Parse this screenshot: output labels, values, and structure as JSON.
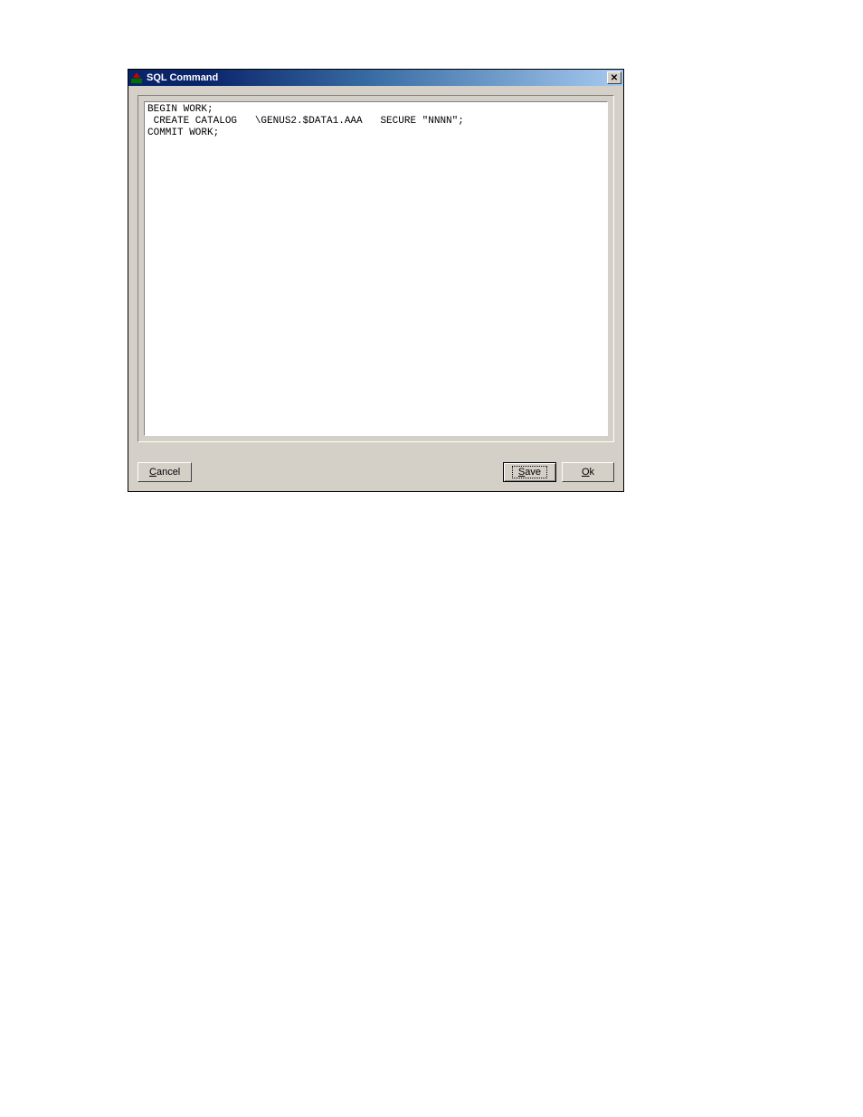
{
  "titlebar": {
    "title": "SQL Command"
  },
  "textarea": {
    "content": "BEGIN WORK;\n CREATE CATALOG   \\GENUS2.$DATA1.AAA   SECURE \"NNNN\";\nCOMMIT WORK;"
  },
  "buttons": {
    "cancel": {
      "u": "C",
      "rest": "ancel"
    },
    "save": {
      "u": "S",
      "rest": "ave"
    },
    "ok": {
      "u": "O",
      "rest": "k"
    }
  }
}
